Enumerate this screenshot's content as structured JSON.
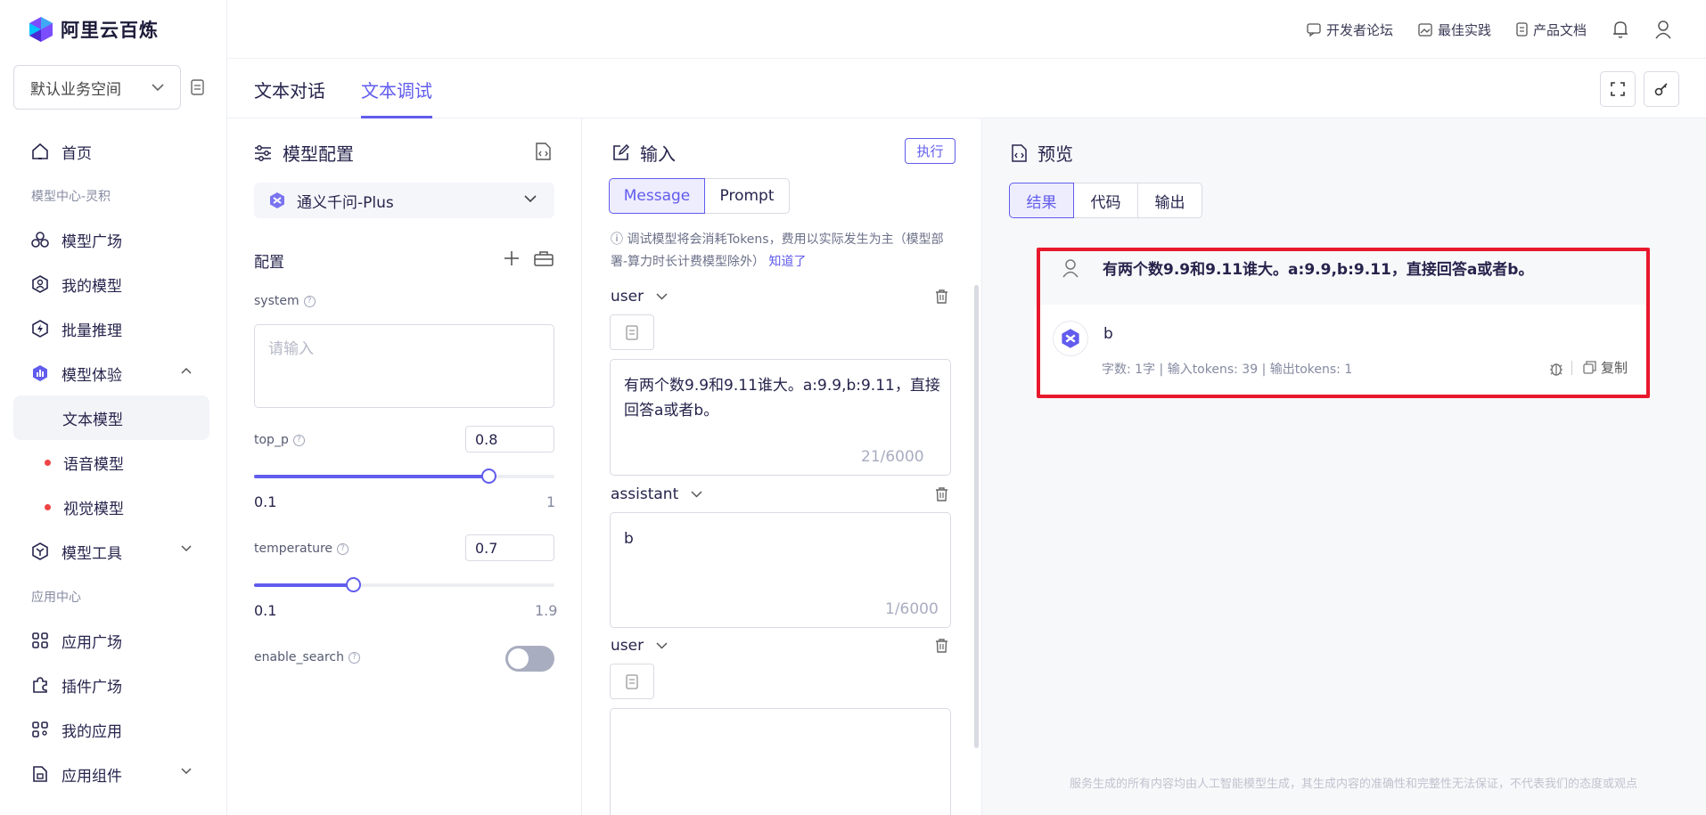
{
  "brand": {
    "name": "阿里云百炼"
  },
  "workspace": {
    "label": "默认业务空间"
  },
  "header": {
    "links": [
      "开发者论坛",
      "最佳实践",
      "产品文档"
    ]
  },
  "sidebar": {
    "home": "首页",
    "section1": "模型中心-灵积",
    "items": [
      "模型广场",
      "我的模型",
      "批量推理",
      "模型体验",
      "文本模型",
      "语音模型",
      "视觉模型",
      "模型工具"
    ],
    "section2": "应用中心",
    "items2": [
      "应用广场",
      "插件广场",
      "我的应用",
      "应用组件"
    ]
  },
  "tabs": [
    "文本对话",
    "文本调试"
  ],
  "config": {
    "title": "模型配置",
    "model": "通义千问-Plus",
    "section": "配置",
    "system_label": "system",
    "system_placeholder": "请输入",
    "top_p": {
      "label": "top_p",
      "value": "0.8",
      "min": "0.1",
      "max": "1",
      "level": 0.78
    },
    "temperature": {
      "label": "temperature",
      "value": "0.7",
      "min": "0.1",
      "max": "1.9",
      "level": 0.33
    },
    "enable_search": {
      "label": "enable_search",
      "on": false
    }
  },
  "input": {
    "title": "输入",
    "execute": "执行",
    "modes": [
      "Message",
      "Prompt"
    ],
    "notice": "调试模型将会消耗Tokens，费用以实际发生为主（模型部署-算力时长计费模型除外）",
    "notice_link": "知道了",
    "messages": [
      {
        "role": "user",
        "text": "有两个数9.9和9.11谁大。a:9.9,b:9.11，直接回答a或者b。",
        "count": "21/6000"
      },
      {
        "role": "assistant",
        "text": "b",
        "count": "1/6000"
      },
      {
        "role": "user",
        "text": "",
        "count": ""
      }
    ]
  },
  "preview": {
    "title": "预览",
    "tabs": [
      "结果",
      "代码",
      "输出"
    ],
    "user_msg": "有两个数9.9和9.11谁大。a:9.9,b:9.11，直接回答a或者b。",
    "ai_msg": "b",
    "meta": "字数: 1字 | 输入tokens: 39 | 输出tokens: 1",
    "copy": "复制",
    "footer": "服务生成的所有内容均由人工智能模型生成，其生成内容的准确性和完整性无法保证，不代表我们的态度或观点"
  }
}
